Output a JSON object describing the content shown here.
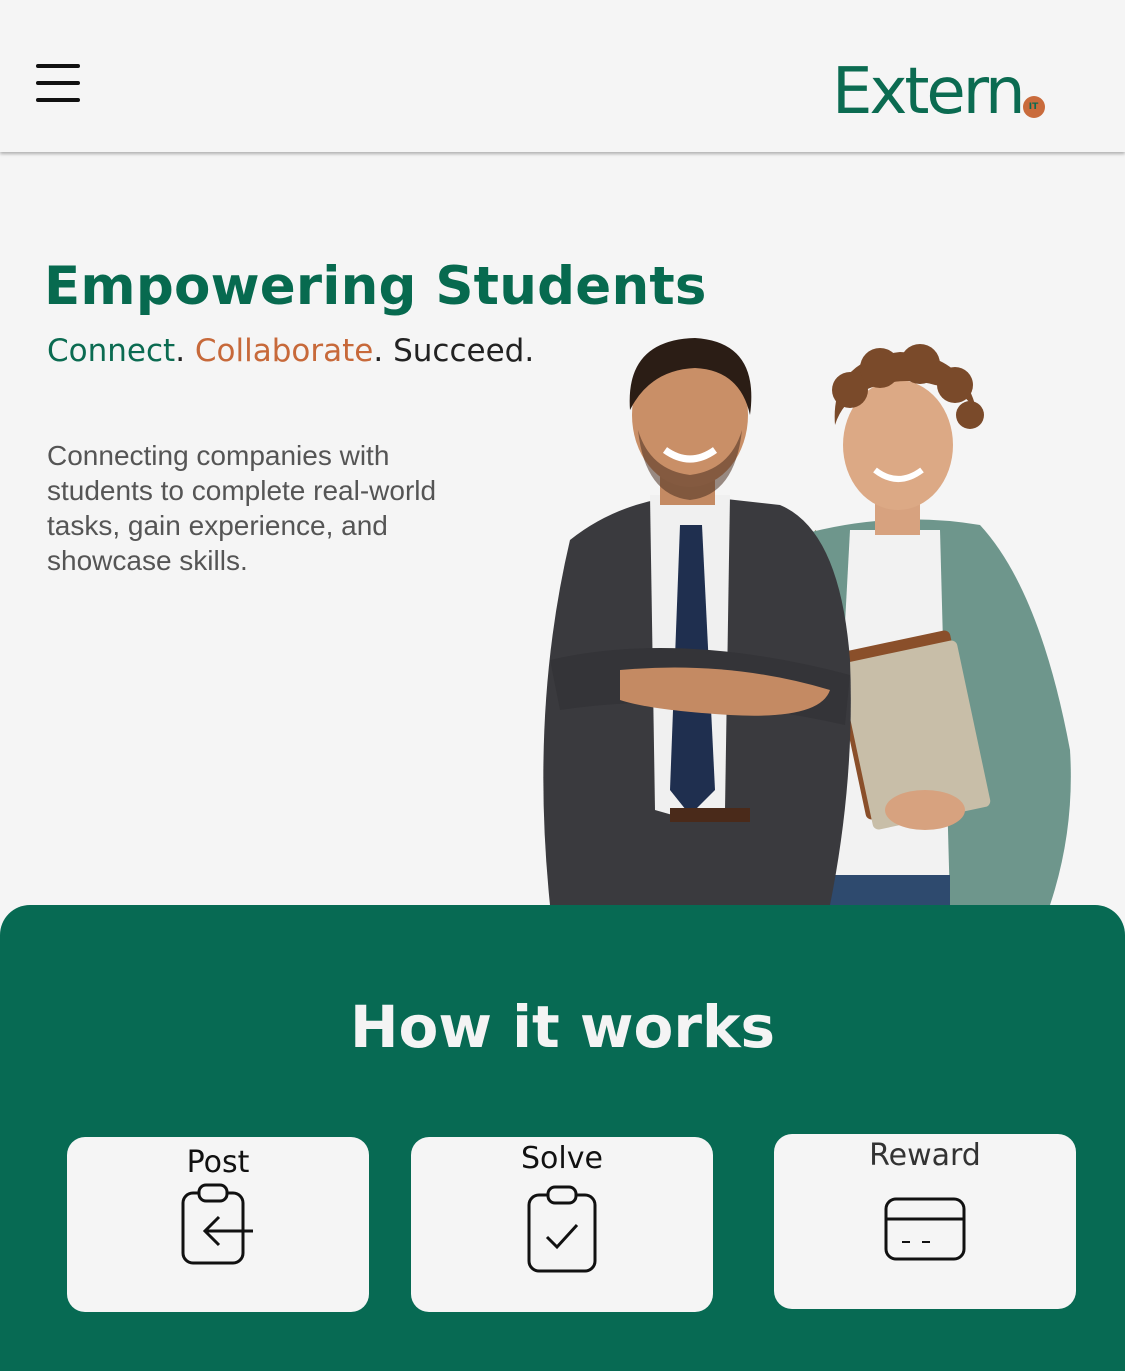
{
  "header": {
    "logo_text": "Extern",
    "logo_badge": "IT",
    "menu_icon": "hamburger-menu-icon"
  },
  "hero": {
    "title": "Empowering Students",
    "tagline": {
      "part1": "Connect",
      "sep1": ". ",
      "part2": "Collaborate",
      "sep2": ". ",
      "part3": "Succeed."
    },
    "description": "Connecting companies with students to complete real-world tasks, gain experience, and showcase skills."
  },
  "how_it_works": {
    "title": "How it works",
    "steps": [
      {
        "label": "Post",
        "icon": "clipboard-arrow-icon"
      },
      {
        "label": "Solve",
        "icon": "clipboard-check-icon"
      },
      {
        "label": "Reward",
        "icon": "credit-card-icon"
      }
    ]
  },
  "colors": {
    "brand_green": "#076a53",
    "accent_orange": "#c7693a",
    "background": "#f5f5f5"
  }
}
